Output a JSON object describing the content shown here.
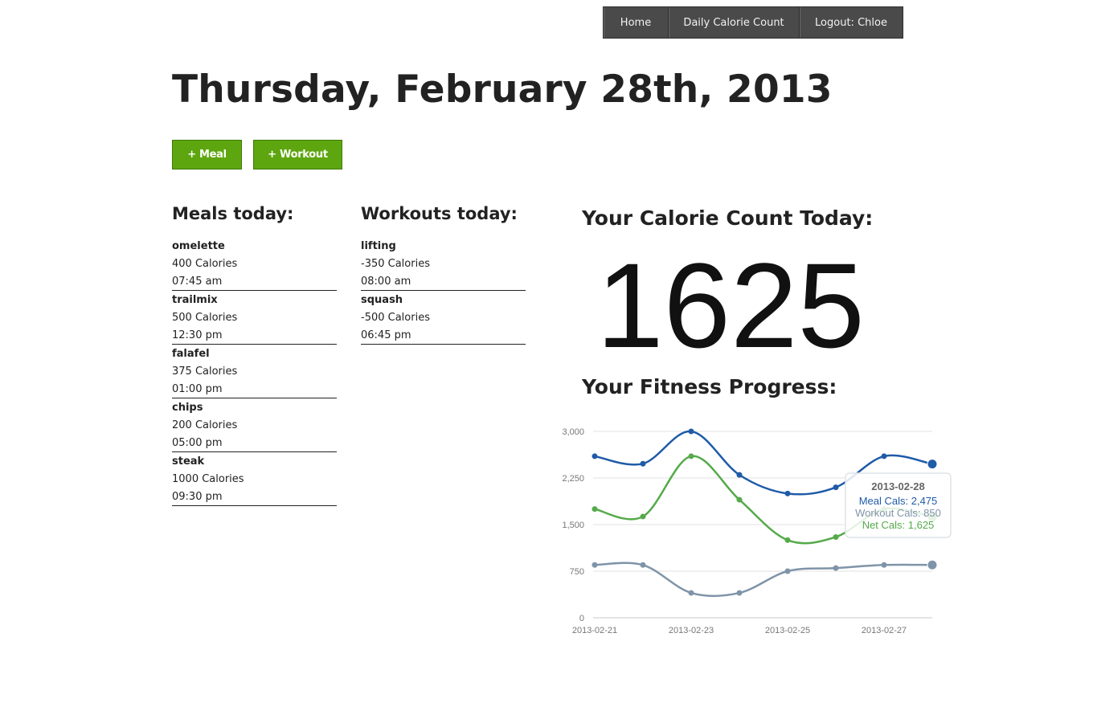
{
  "nav": {
    "home": "Home",
    "daily": "Daily Calorie Count",
    "logout": "Logout: Chloe"
  },
  "page_title": "Thursday, February 28th, 2013",
  "buttons": {
    "meal": "+ Meal",
    "workout": "+ Workout"
  },
  "meals": {
    "title": "Meals today:",
    "items": [
      {
        "name": "omelette",
        "calories": "400 Calories",
        "time": "07:45 am"
      },
      {
        "name": "trailmix",
        "calories": "500 Calories",
        "time": "12:30 pm"
      },
      {
        "name": "falafel",
        "calories": "375 Calories",
        "time": "01:00 pm"
      },
      {
        "name": "chips",
        "calories": "200 Calories",
        "time": "05:00 pm"
      },
      {
        "name": "steak",
        "calories": "1000 Calories",
        "time": "09:30 pm"
      }
    ]
  },
  "workouts": {
    "title": "Workouts today:",
    "items": [
      {
        "name": "lifting",
        "calories": "-350 Calories",
        "time": "08:00 am"
      },
      {
        "name": "squash",
        "calories": "-500 Calories",
        "time": "06:45 pm"
      }
    ]
  },
  "calorie_count": {
    "title": "Your Calorie Count Today:",
    "value": "1625"
  },
  "progress": {
    "title": "Your Fitness Progress:"
  },
  "colors": {
    "meal": "#1f5ba8",
    "workout": "#7f94a8",
    "net": "#55aa4a",
    "button": "#5ea60f",
    "nav": "#4a4a4a"
  },
  "chart_data": {
    "type": "line",
    "x": [
      "2013-02-21",
      "2013-02-22",
      "2013-02-23",
      "2013-02-24",
      "2013-02-25",
      "2013-02-26",
      "2013-02-27",
      "2013-02-28"
    ],
    "x_tick_labels": [
      "2013-02-21",
      "2013-02-23",
      "2013-02-25",
      "2013-02-27"
    ],
    "y_ticks": [
      0,
      750,
      1500,
      2250,
      3000
    ],
    "y_tick_labels": [
      "0",
      "750",
      "1,500",
      "2,250",
      "3,000"
    ],
    "ylim": [
      0,
      3000
    ],
    "grid": true,
    "series": [
      {
        "name": "Meal Cals",
        "color": "#1f5ba8",
        "values": [
          2600,
          2480,
          3000,
          2300,
          2000,
          2100,
          2600,
          2475
        ]
      },
      {
        "name": "Workout Cals",
        "color": "#7f94a8",
        "values": [
          850,
          850,
          400,
          400,
          750,
          800,
          850,
          850
        ]
      },
      {
        "name": "Net Cals",
        "color": "#55aa4a",
        "values": [
          1750,
          1630,
          2600,
          1900,
          1250,
          1300,
          1750,
          1625
        ]
      }
    ],
    "tooltip": {
      "title": "2013-02-28",
      "lines": [
        "Meal Cals: 2,475",
        "Workout Cals: 850",
        "Net Cals: 1,625"
      ]
    }
  }
}
